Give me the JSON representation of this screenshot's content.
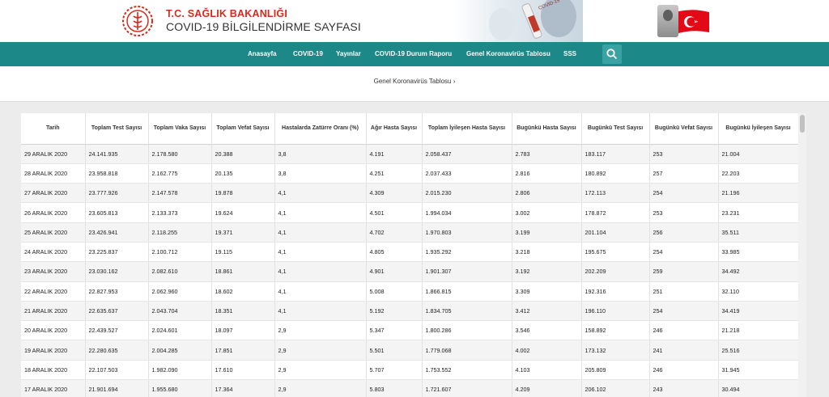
{
  "header": {
    "ministry": "T.C. SAĞLIK BAKANLIĞI",
    "title": "COVID-19 BİLGİLENDİRME SAYFASI",
    "hero_caption": "COVID-19"
  },
  "nav": {
    "items": [
      "Anasayfa",
      "COVID-19",
      "Yayınlar",
      "COVID-19 Durum Raporu",
      "Genel Koronavirüs Tablosu",
      "SSS"
    ]
  },
  "breadcrumb": "Genel Koronavirüs Tablosu ›",
  "colors": {
    "teal": "#1d8888",
    "red": "#d52b1e"
  },
  "table": {
    "headers": [
      "Tarih",
      "Toplam Test Sayısı",
      "Toplam Vaka Sayısı",
      "Toplam Vefat Sayısı",
      "Hastalarda Zatürre Oranı (%)",
      "Ağır Hasta Sayısı",
      "Toplam İyileşen Hasta Sayısı",
      "Bugünkü Hasta Sayısı",
      "Bugünkü Test Sayısı",
      "Bugünkü Vefat Sayısı",
      "Bugünkü İyileşen Sayısı"
    ],
    "rows": [
      [
        "29 ARALIK 2020",
        "24.141.935",
        "2.178.580",
        "20.388",
        "3,8",
        "4.191",
        "2.058.437",
        "2.783",
        "183.117",
        "253",
        "21.004"
      ],
      [
        "28 ARALIK 2020",
        "23.958.818",
        "2.162.775",
        "20.135",
        "3,8",
        "4.251",
        "2.037.433",
        "2.816",
        "180.892",
        "257",
        "22.203"
      ],
      [
        "27 ARALIK 2020",
        "23.777.926",
        "2.147.578",
        "19.878",
        "4,1",
        "4.309",
        "2.015.230",
        "2.806",
        "172.113",
        "254",
        "21.196"
      ],
      [
        "26 ARALIK 2020",
        "23.605.813",
        "2.133.373",
        "19.624",
        "4,1",
        "4.501",
        "1.994.034",
        "3.002",
        "178.872",
        "253",
        "23.231"
      ],
      [
        "25 ARALIK 2020",
        "23.426.941",
        "2.118.255",
        "19.371",
        "4,1",
        "4.702",
        "1.970.803",
        "3.199",
        "201.104",
        "256",
        "35.511"
      ],
      [
        "24 ARALIK 2020",
        "23.225.837",
        "2.100.712",
        "19.115",
        "4,1",
        "4.805",
        "1.935.292",
        "3.218",
        "195.675",
        "254",
        "33.985"
      ],
      [
        "23 ARALIK 2020",
        "23.030.162",
        "2.082.610",
        "18.861",
        "4,1",
        "4.901",
        "1.901.307",
        "3.192",
        "202.209",
        "259",
        "34.492"
      ],
      [
        "22 ARALIK 2020",
        "22.827.953",
        "2.062.960",
        "18.602",
        "4,1",
        "5.008",
        "1.866.815",
        "3.309",
        "192.316",
        "251",
        "32.110"
      ],
      [
        "21 ARALIK 2020",
        "22.635.637",
        "2.043.704",
        "18.351",
        "4,1",
        "5.192",
        "1.834.705",
        "3.412",
        "196.110",
        "254",
        "34.419"
      ],
      [
        "20 ARALIK 2020",
        "22.439.527",
        "2.024.601",
        "18.097",
        "2,9",
        "5.347",
        "1.800.286",
        "3.546",
        "158.892",
        "246",
        "21.218"
      ],
      [
        "19 ARALIK 2020",
        "22.280.635",
        "2.004.285",
        "17.851",
        "2,9",
        "5.501",
        "1.779.068",
        "4.002",
        "173.132",
        "241",
        "25.516"
      ],
      [
        "18 ARALIK 2020",
        "22.107.503",
        "1.982.090",
        "17.610",
        "2,9",
        "5.707",
        "1.753.552",
        "4.103",
        "205.809",
        "246",
        "31.945"
      ],
      [
        "17 ARALIK 2020",
        "21.901.694",
        "1.955.680",
        "17.364",
        "2,9",
        "5.803",
        "1.721.607",
        "4.209",
        "206.102",
        "243",
        "30.494"
      ]
    ]
  }
}
